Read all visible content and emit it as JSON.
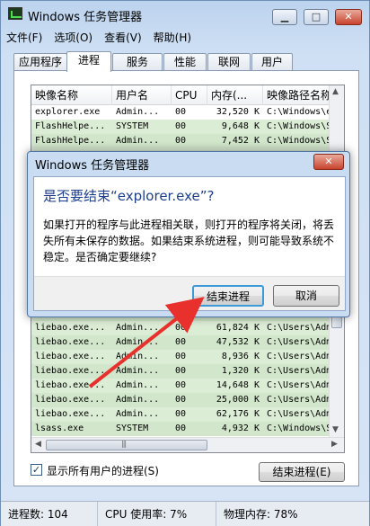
{
  "window": {
    "title": "Windows 任务管理器",
    "controls": {
      "minimize": "▁",
      "maximize": "□",
      "close": "✕"
    }
  },
  "menu": [
    "文件(F)",
    "选项(O)",
    "查看(V)",
    "帮助(H)"
  ],
  "tabs": [
    {
      "label": "应用程序",
      "active": false
    },
    {
      "label": "进程",
      "active": true
    },
    {
      "label": "服务",
      "active": false
    },
    {
      "label": "性能",
      "active": false
    },
    {
      "label": "联网",
      "active": false
    },
    {
      "label": "用户",
      "active": false
    }
  ],
  "columns": [
    "映像名称",
    "用户名",
    "CPU",
    "内存(...",
    "映像路径名称"
  ],
  "processes_top": [
    [
      "explorer.exe",
      "Admin...",
      "00",
      "32,520 K",
      "C:\\Windows\\e"
    ],
    [
      "FlashHelpe...",
      "SYSTEM",
      "00",
      "9,648 K",
      "C:\\Windows\\S"
    ],
    [
      "FlashHelpe...",
      "Admin...",
      "00",
      "7,452 K",
      "C:\\Windows\\S"
    ]
  ],
  "processes_bottom": [
    [
      "liebao.exe...",
      "Admin...",
      "00",
      "61,824 K",
      "C:\\Users\\Adm"
    ],
    [
      "liebao.exe...",
      "Admin...",
      "00",
      "47,532 K",
      "C:\\Users\\Adm"
    ],
    [
      "liebao.exe...",
      "Admin...",
      "00",
      "8,936 K",
      "C:\\Users\\Adm"
    ],
    [
      "liebao.exe...",
      "Admin...",
      "00",
      "1,320 K",
      "C:\\Users\\Adm"
    ],
    [
      "liebao.exe...",
      "Admin...",
      "00",
      "14,648 K",
      "C:\\Users\\Adm"
    ],
    [
      "liebao.exe...",
      "Admin...",
      "00",
      "25,000 K",
      "C:\\Users\\Adm"
    ],
    [
      "liebao.exe...",
      "Admin...",
      "00",
      "62,176 K",
      "C:\\Users\\Adm"
    ],
    [
      "lsass.exe",
      "SYSTEM",
      "00",
      "4,932 K",
      "C:\\Windows\\S"
    ]
  ],
  "show_all_users": {
    "label": "显示所有用户的进程(S)",
    "checked": true
  },
  "end_process_button": "结束进程(E)",
  "status": {
    "processes": "进程数: 104",
    "cpu": "CPU 使用率: 7%",
    "memory": "物理内存: 78%"
  },
  "dialog": {
    "title": "Windows 任务管理器",
    "heading": "是否要结束“explorer.exe”?",
    "message": "如果打开的程序与此进程相关联，则打开的程序将关闭，将丢失所有未保存的数据。如果结束系统进程，则可能导致系统不稳定。是否确定要继续?",
    "confirm": "结束进程",
    "cancel": "取消"
  },
  "accent_colors": {
    "arrow": "#e8312d",
    "row_highlight": "#d6ead0",
    "dialog_heading": "#1d3e8f"
  }
}
